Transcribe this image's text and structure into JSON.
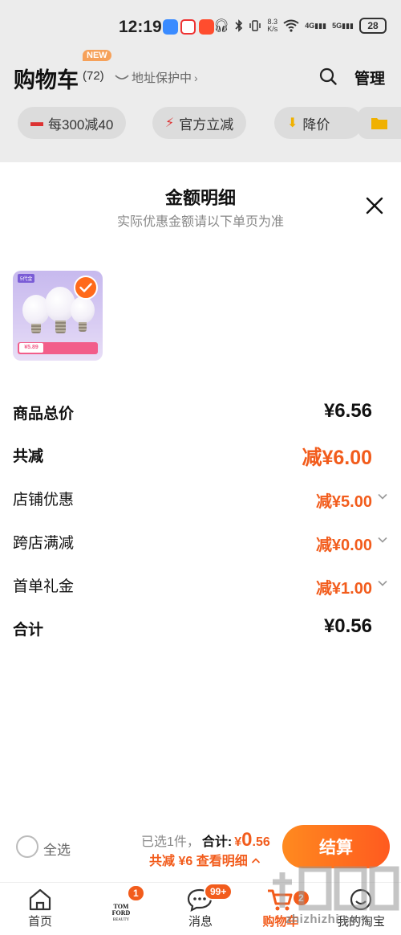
{
  "status_bar": {
    "time": "12:19",
    "net_speed_value": "8.3",
    "net_speed_unit": "K/s",
    "sig1_label": "4G",
    "sig2_label": "5G",
    "battery": "28"
  },
  "header": {
    "title": "购物车",
    "new_badge": "NEW",
    "count": "(72)",
    "address_protect": "地址保护中",
    "manage_label": "管理"
  },
  "promo_chips": [
    {
      "icon": "coupon-icon",
      "label": "每300减40"
    },
    {
      "icon": "lightning-icon",
      "label": "官方立减"
    },
    {
      "icon": "price-drop-icon",
      "label": "降价"
    }
  ],
  "detail_sheet": {
    "title": "金额明细",
    "subtitle": "实际优惠金额请以下单页为准",
    "product": {
      "thumb_tag": "5代金",
      "thumb_price": "¥5.89"
    },
    "rows": [
      {
        "label": "商品总价",
        "value": "¥6.56"
      },
      {
        "label": "共减",
        "value": "减¥6.00"
      },
      {
        "label": "店铺优惠",
        "value": "减¥5.00"
      },
      {
        "label": "跨店满减",
        "value": "减¥0.00"
      },
      {
        "label": "首单礼金",
        "value": "减¥1.00"
      },
      {
        "label": "合计",
        "value": "¥0.56"
      }
    ]
  },
  "checkout": {
    "select_all_label": "全选",
    "selected_info": "已选1件，",
    "total_label": "合计:",
    "total_yen": "¥",
    "total_int": "0",
    "total_dec": ".56",
    "discount_info": "共减 ¥6 查看明细",
    "pay_button": "结算"
  },
  "bottom_nav": {
    "home": "首页",
    "brand_logo": "TOM FORD",
    "brand_sub": "BEAUTY",
    "brand_badge": "1",
    "messages": "消息",
    "messages_badge": "99+",
    "cart": "购物车",
    "cart_badge": "2",
    "mine": "我的淘宝"
  },
  "watermark_text": "zhizhizhi.com",
  "colors": {
    "accent": "#f25c1c",
    "checkout_gradient_start": "#ff8a1f",
    "checkout_gradient_end": "#ff5a1f",
    "overlay_bg": "#ececec"
  }
}
